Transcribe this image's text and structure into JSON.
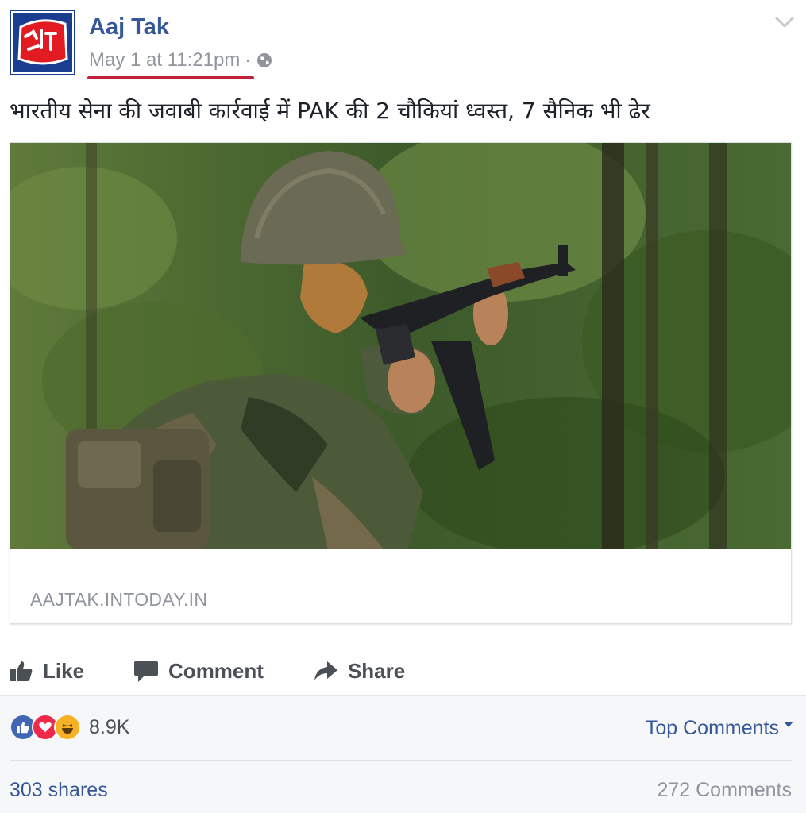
{
  "post": {
    "page_name": "Aaj Tak",
    "timestamp": "May 1 at 11:21pm",
    "separator": "·",
    "privacy_icon": "globe-icon",
    "avatar_logo_text": "आज तक",
    "text": "भारतीय सेना की जवाबी कार्रवाई में PAK की 2 चौकियां ध्वस्त, 7 सैनिक भी ढेर"
  },
  "link_card": {
    "image_icon": "soldier-photo",
    "domain": "AAJTAK.INTODAY.IN"
  },
  "actions": {
    "like": "Like",
    "comment": "Comment",
    "share": "Share"
  },
  "footer": {
    "reactions": [
      "like-reaction-icon",
      "love-reaction-icon",
      "haha-reaction-icon"
    ],
    "reaction_count": "8.9K",
    "top_comments": "Top Comments",
    "shares": "303 shares",
    "comments": "272 Comments"
  },
  "colors": {
    "link_blue": "#365899",
    "grey_text": "#90949c",
    "underline_red": "#c0223a",
    "like_blue": "#4267b2",
    "love_red": "#f0284a",
    "haha_yellow": "#f7b125"
  }
}
